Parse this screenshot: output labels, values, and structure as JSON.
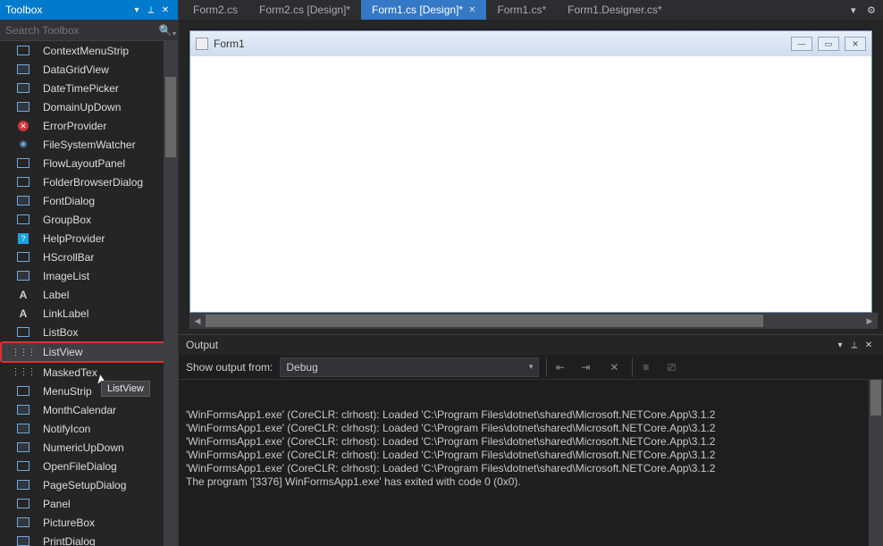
{
  "toolbox": {
    "title": "Toolbox",
    "search_placeholder": "Search Toolbox",
    "items": [
      {
        "icon": "box",
        "label": "ContextMenuStrip"
      },
      {
        "icon": "boxf",
        "label": "DataGridView"
      },
      {
        "icon": "boxf",
        "label": "DateTimePicker"
      },
      {
        "icon": "boxf",
        "label": "DomainUpDown"
      },
      {
        "icon": "err",
        "label": "ErrorProvider"
      },
      {
        "icon": "eye",
        "label": "FileSystemWatcher"
      },
      {
        "icon": "box",
        "label": "FlowLayoutPanel"
      },
      {
        "icon": "box",
        "label": "FolderBrowserDialog"
      },
      {
        "icon": "boxf",
        "label": "FontDialog"
      },
      {
        "icon": "box",
        "label": "GroupBox"
      },
      {
        "icon": "q",
        "label": "HelpProvider"
      },
      {
        "icon": "box",
        "label": "HScrollBar"
      },
      {
        "icon": "boxf",
        "label": "ImageList"
      },
      {
        "icon": "a",
        "label": "Label"
      },
      {
        "icon": "a",
        "label": "LinkLabel"
      },
      {
        "icon": "box",
        "label": "ListBox"
      },
      {
        "icon": "dots",
        "label": "ListView",
        "highlight": true,
        "hovered": true
      },
      {
        "icon": "dots",
        "label": "MaskedTex"
      },
      {
        "icon": "box",
        "label": "MenuStrip"
      },
      {
        "icon": "boxf",
        "label": "MonthCalendar"
      },
      {
        "icon": "boxf",
        "label": "NotifyIcon"
      },
      {
        "icon": "boxf",
        "label": "NumericUpDown"
      },
      {
        "icon": "box",
        "label": "OpenFileDialog"
      },
      {
        "icon": "boxf",
        "label": "PageSetupDialog"
      },
      {
        "icon": "box",
        "label": "Panel"
      },
      {
        "icon": "boxf",
        "label": "PictureBox"
      },
      {
        "icon": "boxf",
        "label": "PrintDialog"
      }
    ],
    "tooltip": "ListView"
  },
  "tabs": {
    "items": [
      {
        "label": "Form2.cs",
        "close": false
      },
      {
        "label": "Form2.cs [Design]*",
        "close": false
      },
      {
        "label": "Form1.cs [Design]*",
        "close": true,
        "active": true
      },
      {
        "label": "Form1.cs*",
        "close": false
      },
      {
        "label": "Form1.Designer.cs*",
        "close": false
      }
    ]
  },
  "form": {
    "title": "Form1"
  },
  "output": {
    "title": "Output",
    "show_from_label": "Show output from:",
    "source": "Debug",
    "lines": [
      "'WinFormsApp1.exe' (CoreCLR: clrhost): Loaded 'C:\\Program Files\\dotnet\\shared\\Microsoft.NETCore.App\\3.1.2",
      "'WinFormsApp1.exe' (CoreCLR: clrhost): Loaded 'C:\\Program Files\\dotnet\\shared\\Microsoft.NETCore.App\\3.1.2",
      "'WinFormsApp1.exe' (CoreCLR: clrhost): Loaded 'C:\\Program Files\\dotnet\\shared\\Microsoft.NETCore.App\\3.1.2",
      "'WinFormsApp1.exe' (CoreCLR: clrhost): Loaded 'C:\\Program Files\\dotnet\\shared\\Microsoft.NETCore.App\\3.1.2",
      "'WinFormsApp1.exe' (CoreCLR: clrhost): Loaded 'C:\\Program Files\\dotnet\\shared\\Microsoft.NETCore.App\\3.1.2",
      "The program '[3376] WinFormsApp1.exe' has exited with code 0 (0x0)."
    ]
  }
}
